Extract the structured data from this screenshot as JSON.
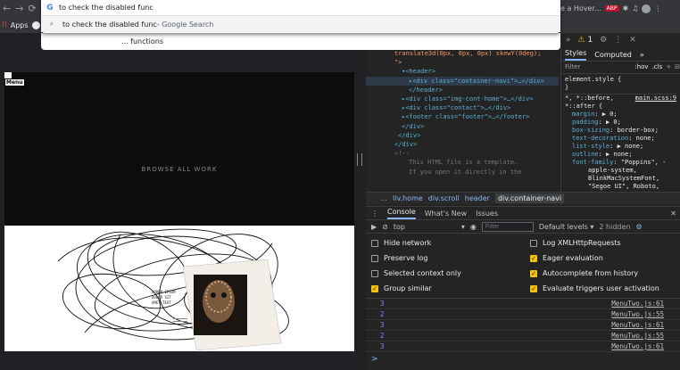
{
  "omnibox": {
    "query": "to check the disabled func",
    "suggestion": "to check the disabled func",
    "suggestion_suffix": " - Google Search",
    "suggestion2": "... functions"
  },
  "bookmarks": {
    "apps_label": "Apps"
  },
  "extensions": {
    "hover_label": "e a Hover...",
    "abp_label": "ABP"
  },
  "page": {
    "menu_label": "Menu",
    "browse_label": "BROWSE ALL WORK"
  },
  "devtools": {
    "warnings_count": "1",
    "elements_lines": [
      "translate3d(0px, 0px, 0px) skewY(0deg);",
      "\">",
      "<header>",
      "<div class=\"container-navi\">…</div>",
      "</header>",
      "<div class=\"img-cont-home\">…</div>",
      "<div class=\"contact\">…</div>",
      "<footer class=\"footer\">…</footer>",
      "</div>",
      "</div>",
      "</div>",
      "<!--",
      "This HTML file is a template.",
      "If you open it directly in the"
    ],
    "styles_tabs": {
      "styles": "Styles",
      "computed": "Computed"
    },
    "styles_filter": "Filter",
    "styles_hov": ":hov",
    "styles_cls": ".cls",
    "element_style": "element.style {",
    "element_style_close": "}",
    "rule_selector": "*, *::before,",
    "rule_selector2": "*::after {",
    "rule_source": "main.scss:9",
    "props": [
      {
        "name": "margin",
        "value": "▶ 0;"
      },
      {
        "name": "padding",
        "value": "▶ 0;"
      },
      {
        "name": "box-sizing",
        "value": "border-box;"
      },
      {
        "name": "text-decoration",
        "value": "none;"
      },
      {
        "name": "list-style",
        "value": "▶ none;"
      },
      {
        "name": "outline",
        "value": "▶ none;"
      },
      {
        "name": "font-family",
        "value": "\"Poppins\", -"
      }
    ],
    "font_family_cont": [
      "apple-system,",
      "BlinkMacSystemFont,",
      "\"Segoe UI\", Roboto,"
    ],
    "breadcrumbs": [
      "liv.home",
      "div.scroll",
      "header",
      "div.container-navi"
    ],
    "drawer_tabs": [
      "Console",
      "What's New",
      "Issues"
    ],
    "context": "top",
    "filter_placeholder": "Filter",
    "levels": "Default levels ▾",
    "hidden": "2 hidden",
    "settings_left": [
      {
        "label": "Hide network",
        "checked": false
      },
      {
        "label": "Preserve log",
        "checked": false
      },
      {
        "label": "Selected context only",
        "checked": false
      },
      {
        "label": "Group similar",
        "checked": true
      }
    ],
    "settings_right": [
      {
        "label": "Log XMLHttpRequests",
        "checked": false
      },
      {
        "label": "Eager evaluation",
        "checked": true
      },
      {
        "label": "Autocomplete from history",
        "checked": true
      },
      {
        "label": "Evaluate triggers user activation",
        "checked": true
      }
    ],
    "logs": [
      {
        "value": "3",
        "source": "MenuTwo.js:61"
      },
      {
        "value": "2",
        "source": "MenuTwo.js:55"
      },
      {
        "value": "3",
        "source": "MenuTwo.js:61"
      },
      {
        "value": "2",
        "source": "MenuTwo.js:55"
      },
      {
        "value": "3",
        "source": "MenuTwo.js:61"
      }
    ],
    "prompt": ">"
  }
}
